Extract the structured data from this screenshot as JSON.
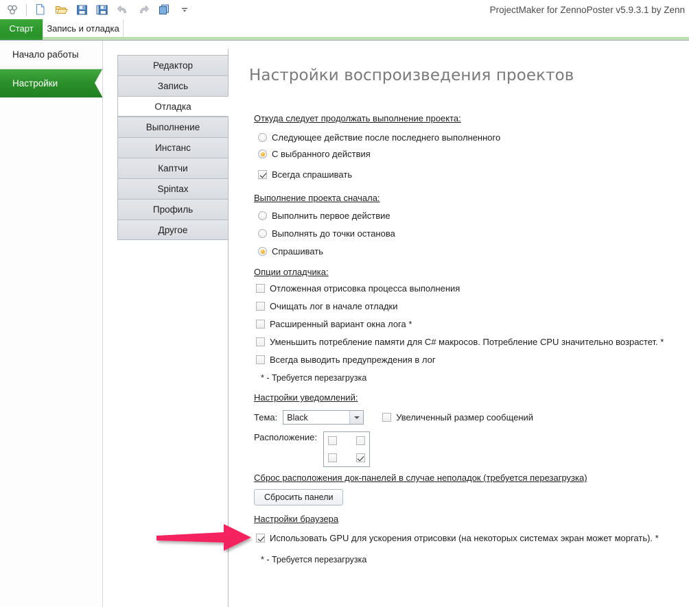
{
  "window": {
    "title": "ProjectMaker for ZennoPoster v5.9.3.1 by Zenn"
  },
  "toolbar": {
    "buttons": [
      {
        "name": "app-logo-icon",
        "label": ""
      },
      {
        "name": "new-file-icon",
        "label": ""
      },
      {
        "name": "open-folder-icon",
        "label": ""
      },
      {
        "name": "save-icon",
        "label": ""
      },
      {
        "name": "save-all-icon",
        "label": ""
      },
      {
        "name": "undo-icon",
        "label": ""
      },
      {
        "name": "redo-icon",
        "label": ""
      },
      {
        "name": "copy-icon",
        "label": ""
      },
      {
        "name": "overflow-chevron-icon",
        "label": ""
      }
    ]
  },
  "ribbon_tabs": [
    {
      "label": "Старт",
      "active": true
    },
    {
      "label": "Запись и отладка",
      "active": false
    }
  ],
  "sidebar": {
    "items": [
      {
        "label": "Начало работы",
        "selected": false
      },
      {
        "label": "Настройки",
        "selected": true
      }
    ]
  },
  "vtabs": [
    {
      "label": "Редактор",
      "active": false
    },
    {
      "label": "Запись",
      "active": false
    },
    {
      "label": "Отладка",
      "active": true
    },
    {
      "label": "Выполнение",
      "active": false
    },
    {
      "label": "Инстанс",
      "active": false
    },
    {
      "label": "Каптчи",
      "active": false
    },
    {
      "label": "Spintax",
      "active": false
    },
    {
      "label": "Профиль",
      "active": false
    },
    {
      "label": "Другое",
      "active": false
    }
  ],
  "page": {
    "title": "Настройки воспроизведения проектов",
    "section_resume": {
      "heading": "Откуда следует продолжать выполнение проекта:",
      "radios": [
        {
          "label": "Следующее действие после последнего выполненного",
          "checked": false
        },
        {
          "label": "С выбранного действия",
          "checked": true
        }
      ],
      "checkbox": {
        "label": "Всегда спрашивать",
        "checked": true
      }
    },
    "section_start": {
      "heading": "Выполнение проекта сначала:",
      "radios": [
        {
          "label": "Выполнить первое действие",
          "checked": false
        },
        {
          "label": "Выполнять до точки останова",
          "checked": false
        },
        {
          "label": "Спрашивать",
          "checked": true
        }
      ]
    },
    "section_debugger": {
      "heading": "Опции отладчика:",
      "checkboxes": [
        {
          "label": "Отложенная отрисовка процесса выполнения",
          "checked": false
        },
        {
          "label": "Очищать лог в начале отладки",
          "checked": false
        },
        {
          "label": "Расширенный вариант окна лога *",
          "checked": false
        },
        {
          "label": "Уменьшить потребление памяти для C# макросов. Потребление CPU значительно возрастет. *",
          "checked": false
        },
        {
          "label": "Всегда выводить предупреждения в лог",
          "checked": false
        }
      ],
      "footnote": "* - Требуется перезагрузка"
    },
    "section_notifications": {
      "heading": "Настройки уведомлений:",
      "theme_label": "Тема:",
      "theme_value": "Black",
      "big_messages": {
        "label": "Увеличенный размер сообщений",
        "checked": false
      },
      "position_label": "Расположение:",
      "position_cells": [
        {
          "name": "top-left",
          "checked": false
        },
        {
          "name": "top-right",
          "checked": false
        },
        {
          "name": "bottom-left",
          "checked": false
        },
        {
          "name": "bottom-right",
          "checked": true
        }
      ]
    },
    "section_dock": {
      "heading": "Сброс расположения док-панелей в случае неполадок (требуется перезагрузка)",
      "button_label": "Сбросить панели"
    },
    "section_browser": {
      "heading": "Настройки браузера",
      "checkbox": {
        "label": "Использовать GPU для ускорения отрисовки (на некоторых системах экран может моргать). *",
        "checked": true
      },
      "footnote": "* - Требуется перезагрузка"
    }
  },
  "annotation": {
    "arrow_color": "#f4245e"
  }
}
